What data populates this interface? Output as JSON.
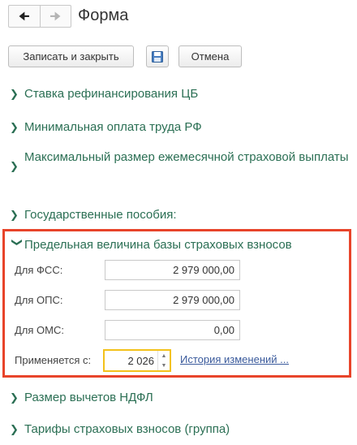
{
  "header": {
    "back_icon": "arrow-left-icon",
    "forward_icon": "arrow-right-icon",
    "title": "Форма"
  },
  "toolbar": {
    "save_close_label": "Записать и закрыть",
    "disk_icon": "floppy-disk-icon",
    "cancel_label": "Отмена"
  },
  "sections": [
    {
      "label": "Ставка рефинансирования ЦБ",
      "expanded": false
    },
    {
      "label": "Минимальная оплата труда РФ",
      "expanded": false
    },
    {
      "label": "Максимальный размер ежемесячной страховой выплаты",
      "expanded": false
    },
    {
      "label": "Государственные пособия:",
      "expanded": false
    },
    {
      "label": "Предельная величина базы страховых взносов",
      "expanded": true
    },
    {
      "label": "Размер вычетов НДФЛ",
      "expanded": false
    },
    {
      "label": "Тарифы страховых взносов (группа)",
      "expanded": false
    }
  ],
  "expanded_section": {
    "fields": [
      {
        "label": "Для ФСС:",
        "value": "2 979 000,00"
      },
      {
        "label": "Для ОПС:",
        "value": "2 979 000,00"
      },
      {
        "label": "Для ОМС:",
        "value": "0,00"
      }
    ],
    "applies_label": "Применяется с:",
    "year_value": "2 026",
    "history_link": "История изменений ..."
  },
  "colors": {
    "section_text": "#2b6f54",
    "highlight_frame": "#e8442a",
    "year_focus": "#f3c21b",
    "link": "#3a5a9c"
  }
}
